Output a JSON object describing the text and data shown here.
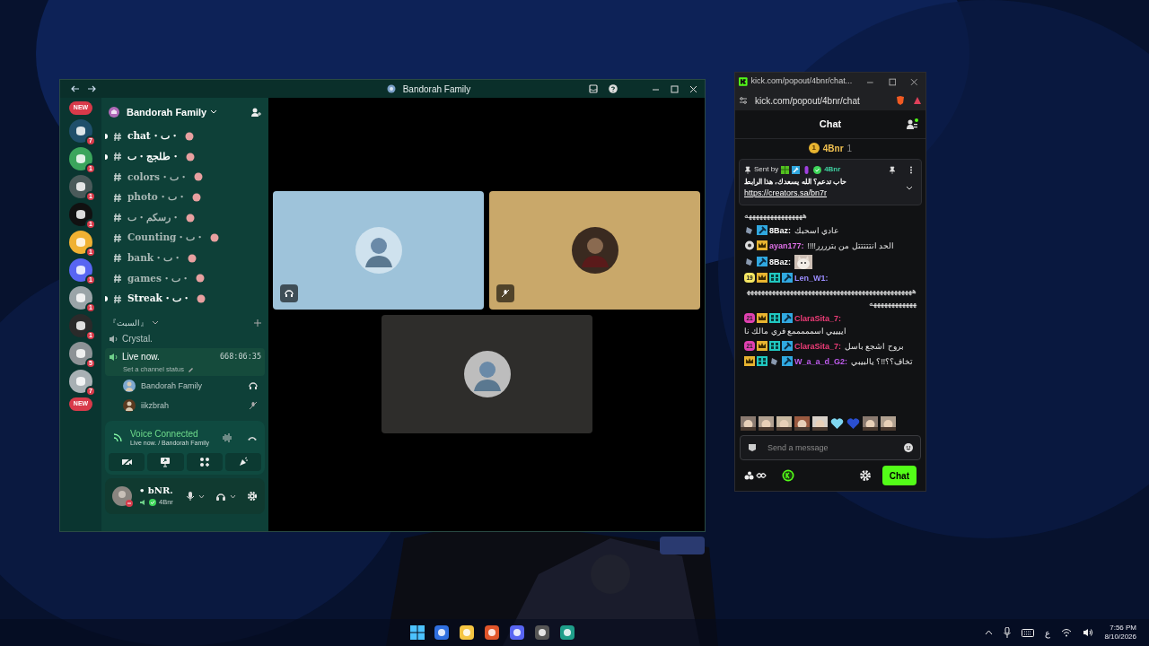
{
  "discord": {
    "title": "Bandorah Family",
    "servers": [
      {
        "kind": "new",
        "label": "NEW"
      },
      {
        "kind": "server",
        "badge": "7",
        "color": "#1f4f6b"
      },
      {
        "kind": "server",
        "badge": "1",
        "color": "#3ba55c"
      },
      {
        "kind": "server",
        "badge": "1",
        "color": "#4a5a5a"
      },
      {
        "kind": "server",
        "badge": "1",
        "color": "#111111"
      },
      {
        "kind": "server",
        "badge": "1",
        "color": "#f0b132"
      },
      {
        "kind": "server",
        "badge": "1",
        "color": "#5865f2"
      },
      {
        "kind": "server",
        "badge": "1",
        "color": "#9aa4a8"
      },
      {
        "kind": "server",
        "badge": "1",
        "color": "#2a2a2a"
      },
      {
        "kind": "server",
        "badge": "5",
        "color": "#8d9296"
      },
      {
        "kind": "server",
        "badge": "7",
        "color": "#a8b0b4"
      },
      {
        "kind": "new",
        "label": "NEW"
      }
    ],
    "server_name": "Bandorah Family",
    "channels": [
      {
        "name": "chat・ٮ・",
        "unread": true
      },
      {
        "name": "طلجج・ٮ・",
        "unread": true
      },
      {
        "name": "colors・ٮ・",
        "unread": false
      },
      {
        "name": "photo・ٮ・",
        "unread": false
      },
      {
        "name": "رسكم・ٮ・",
        "unread": false
      },
      {
        "name": "Counting・ٮ・",
        "unread": false
      },
      {
        "name": "bank・ٮ・",
        "unread": false
      },
      {
        "name": "games・ٮ・",
        "unread": false
      },
      {
        "name": "Streak・ٮ・",
        "unread": true
      }
    ],
    "category": "『السبت』",
    "voice_channels": [
      {
        "name": "Crystal.",
        "active": false
      },
      {
        "name": "Live now.",
        "active": true,
        "timer": "668:06:35",
        "status": "Set a channel status",
        "members": [
          {
            "name": "Bandorah Family",
            "kind": "streaming"
          },
          {
            "name": "iikzbrah",
            "kind": "muted"
          }
        ]
      }
    ],
    "voice_panel": {
      "title": "Voice Connected",
      "subtitle": "Live now. / Bandorah Family"
    },
    "user": {
      "name": "• bNR.",
      "tag": "4Bnr"
    },
    "tiles": [
      {
        "kind": "stream",
        "color": "#9ec3da"
      },
      {
        "kind": "muted",
        "color": "#c9a86a"
      },
      {
        "kind": "plain",
        "color": "#2e2d2b"
      }
    ]
  },
  "kick": {
    "window_title": "kick.com/popout/4bnr/chat...",
    "url": "kick.com/popout/4bnr/chat",
    "header": "Chat",
    "leader": {
      "rank": "1",
      "name": "4Bnr",
      "count": "1"
    },
    "pinned": {
      "label": "Sent by",
      "name": "4Bnr",
      "text": "حاب تدعم؟ الله يسعدك، هذا الرابط",
      "link": "https://creators.sa/bn7r"
    },
    "messages": [
      {
        "kind": "text",
        "text": "ههههههههههههههههه"
      },
      {
        "kind": "text",
        "user": "8Baz:",
        "color": "#ffffff",
        "badges": [
          {
            "kind": "bot"
          },
          {
            "kind": "mod"
          }
        ],
        "text": "عادي اسحبك"
      },
      {
        "kind": "text",
        "user": "ayan177:",
        "color": "#e070e8",
        "badges": [
          {
            "kind": "dot"
          },
          {
            "kind": "crown"
          }
        ],
        "text": "الحد انتتتتتل من بترررر!!!!"
      },
      {
        "kind": "emote",
        "user": "8Baz:",
        "color": "#ffffff",
        "badges": [
          {
            "kind": "bot"
          },
          {
            "kind": "mod"
          }
        ]
      },
      {
        "kind": "text",
        "user": "Len_W1:",
        "color": "#9b8cff",
        "badges": [
          {
            "kind": "sub",
            "label": "19",
            "color": "#f5e663"
          },
          {
            "kind": "crown"
          },
          {
            "kind": "og"
          },
          {
            "kind": "mod"
          }
        ],
        "text": "هههههههههههههههههههههههههههههههههههههههههههههههههههههههههههه"
      },
      {
        "kind": "text",
        "user": "ClaraSita_7:",
        "color": "#f03c78",
        "badges": [
          {
            "kind": "sub",
            "label": "21",
            "color": "#e040b0"
          },
          {
            "kind": "crown"
          },
          {
            "kind": "og"
          },
          {
            "kind": "mod"
          }
        ],
        "text": "اييييي اسمممممع فري مالك نا"
      },
      {
        "kind": "text",
        "user": "ClaraSita_7:",
        "color": "#f03c78",
        "badges": [
          {
            "kind": "sub",
            "label": "21",
            "color": "#e040b0"
          },
          {
            "kind": "crown"
          },
          {
            "kind": "og"
          },
          {
            "kind": "mod"
          }
        ],
        "text": "بروح اشجع باسل"
      },
      {
        "kind": "text",
        "user": "W_a_a_d_G2:",
        "color": "#c05cf0",
        "badges": [
          {
            "kind": "crown"
          },
          {
            "kind": "og"
          },
          {
            "kind": "bot"
          },
          {
            "kind": "mod"
          }
        ],
        "text": "تخاف؟؟!!؟ يالبيبي"
      }
    ],
    "emotes": [
      {
        "kind": "picture"
      },
      {
        "kind": "picture"
      },
      {
        "kind": "picture"
      },
      {
        "kind": "picture"
      },
      {
        "kind": "picture"
      },
      {
        "kind": "heart",
        "color": "#7fd6f0"
      },
      {
        "kind": "heart",
        "color": "#2a4fd0"
      },
      {
        "kind": "picture"
      },
      {
        "kind": "picture"
      }
    ],
    "input": {
      "placeholder": "Send a message"
    },
    "send": "Chat"
  },
  "taskbar": {
    "apps": [
      {
        "kind": "start"
      },
      {
        "kind": "app",
        "color": "#2f6fe0"
      },
      {
        "kind": "app",
        "color": "#f5c542"
      },
      {
        "kind": "app",
        "color": "#e0552a"
      },
      {
        "kind": "app",
        "color": "#5865f2"
      },
      {
        "kind": "app",
        "color": "#555555"
      },
      {
        "kind": "app",
        "color": "#1f9f8a"
      }
    ],
    "lang": "ع",
    "time": "7:56 PM",
    "date": "8/10/2026"
  }
}
